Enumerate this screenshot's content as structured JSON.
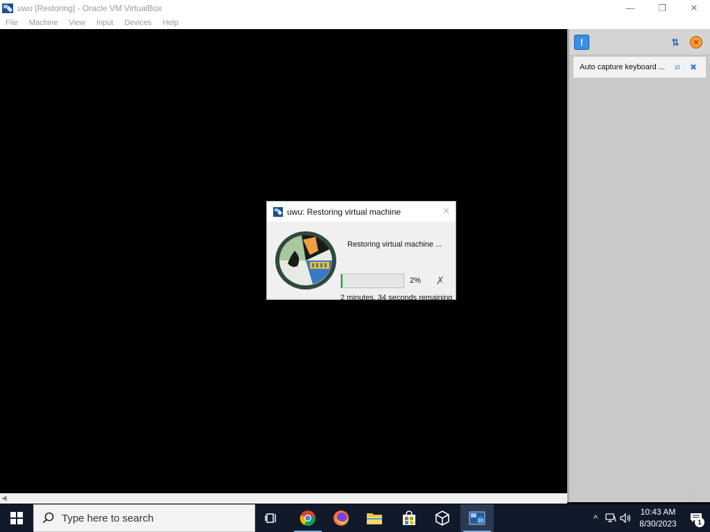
{
  "window": {
    "title": "uwu [Restoring] - Oracle VM VirtualBox",
    "controls": {
      "minimize": "—",
      "restore": "❐",
      "close": "✕"
    }
  },
  "menubar": {
    "items": [
      "File",
      "Machine",
      "View",
      "Input",
      "Devices",
      "Help"
    ]
  },
  "notification_pane": {
    "message": "Auto capture keyboard ..."
  },
  "dialog": {
    "title": "uwu: Restoring virtual machine",
    "message": "Restoring virtual machine ...",
    "progress_percent": 2,
    "progress_label": "2%",
    "remaining": "2 minutes, 34 seconds remaining",
    "progress_color": "#06b025"
  },
  "taskbar": {
    "search_placeholder": "Type here to search",
    "apps": [
      "task-view",
      "chrome",
      "firefox",
      "file-explorer",
      "microsoft-store",
      "virtualbox",
      "virtualbox-vm"
    ],
    "clock_time": "10:43 AM",
    "clock_date": "8/30/2023",
    "notification_count": "1"
  }
}
